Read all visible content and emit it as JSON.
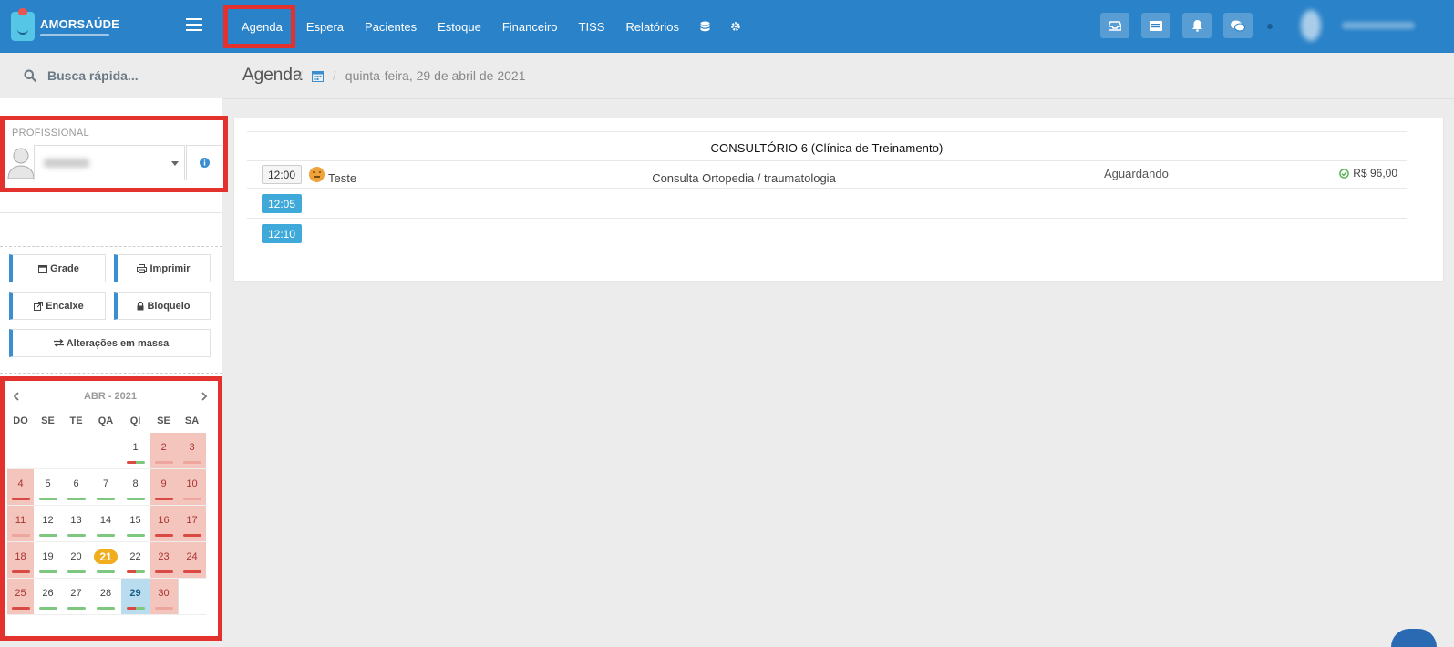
{
  "app": {
    "logo_name": "AMORSAÚDE"
  },
  "nav": {
    "items": [
      "Agenda",
      "Espera",
      "Pacientes",
      "Estoque",
      "Financeiro",
      "TISS",
      "Relatórios"
    ]
  },
  "sidebar": {
    "search_placeholder": "Busca rápida...",
    "professional_label": "PROFISSIONAL",
    "actions": {
      "grade": "Grade",
      "imprimir": "Imprimir",
      "encaixe": "Encaixe",
      "bloqueio": "Bloqueio",
      "alteracoes": "Alterações em massa"
    }
  },
  "calendar": {
    "month_label": "ABR - 2021",
    "weekdays": [
      "DO",
      "SE",
      "TE",
      "QA",
      "QI",
      "SE",
      "SA"
    ],
    "weeks": [
      [
        "",
        "",
        "",
        "",
        "1",
        "2",
        "3"
      ],
      [
        "4",
        "5",
        "6",
        "7",
        "8",
        "9",
        "10"
      ],
      [
        "11",
        "12",
        "13",
        "14",
        "15",
        "16",
        "17"
      ],
      [
        "18",
        "19",
        "20",
        "21",
        "22",
        "23",
        "24"
      ],
      [
        "25",
        "26",
        "27",
        "28",
        "29",
        "30",
        ""
      ]
    ],
    "highlighted_day": "21",
    "selected_day": "29"
  },
  "main": {
    "title": "Agenda",
    "breadcrumb_date": "quinta-feira, 29 de abril de 2021",
    "room": "CONSULTÓRIO 6 (Clínica de Treinamento)",
    "slots": [
      {
        "time": "12:00",
        "patient": "Teste",
        "procedure": "Consulta Ortopedia / traumatologia",
        "status": "Aguardando",
        "value": "R$ 96,00"
      },
      {
        "time": "12:05",
        "patient": "",
        "procedure": "",
        "status": "",
        "value": ""
      },
      {
        "time": "12:10",
        "patient": "",
        "procedure": "",
        "status": "",
        "value": ""
      }
    ]
  },
  "colors": {
    "topbar": "#2a82c8",
    "highlight_box": "#e3312d",
    "slot_blue": "#3fa9d9",
    "weekend": "#f4c5bd",
    "badge": "#f0ad1e"
  }
}
